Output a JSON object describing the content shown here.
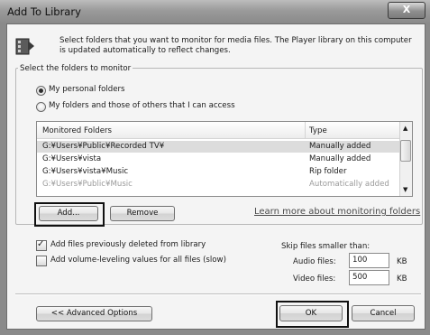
{
  "window": {
    "title": "Add To Library",
    "close_glyph": "X"
  },
  "info": {
    "icon": "media-library-icon",
    "text": "Select folders that you want to monitor for media files. The Player library on this computer is updated automatically to reflect changes."
  },
  "select_group": {
    "label": "Select the folders to monitor",
    "options": [
      {
        "label": "My personal folders",
        "selected": true
      },
      {
        "label": "My folders and those of others that I can access",
        "selected": false
      }
    ]
  },
  "list": {
    "columns": [
      "Monitored Folders",
      "Type"
    ],
    "rows": [
      {
        "folder": "G:¥Users¥Public¥Recorded TV¥",
        "type": "Manually added",
        "style": "selected"
      },
      {
        "folder": "G:¥Users¥vista",
        "type": "Manually added",
        "style": "normal"
      },
      {
        "folder": "G:¥Users¥vista¥Music",
        "type": "Rip folder",
        "style": "normal"
      },
      {
        "folder": "G:¥Users¥Public¥Music",
        "type": "Automatically added",
        "style": "dim"
      }
    ]
  },
  "buttons": {
    "add": "Add...",
    "remove": "Remove",
    "advanced": "<< Advanced Options",
    "ok": "OK",
    "cancel": "Cancel"
  },
  "learn_more_link": "Learn more about monitoring folders",
  "options": {
    "add_deleted": {
      "label": "Add files previously deleted from library",
      "checked": true
    },
    "add_volume": {
      "label": "Add volume-leveling values for all files (slow)",
      "checked": false
    }
  },
  "skip": {
    "heading": "Skip files smaller than:",
    "audio_label": "Audio files:",
    "audio_value": "100",
    "audio_unit": "KB",
    "video_label": "Video files:",
    "video_value": "500",
    "video_unit": "KB"
  },
  "colors": {
    "highlight_border": "#111111",
    "selected_row": "#dcdcdc"
  }
}
